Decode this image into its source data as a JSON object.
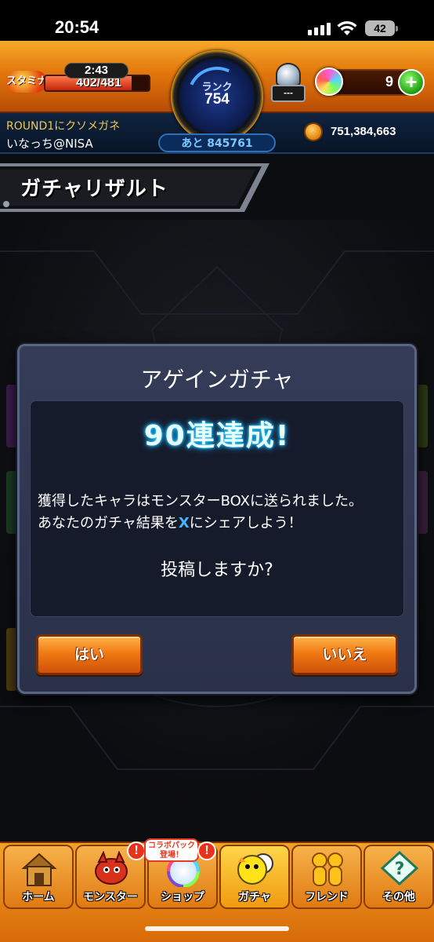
{
  "status_bar": {
    "time": "20:54",
    "battery": "42"
  },
  "hud": {
    "stamina_label": "スタミナ",
    "stamina_timer": "2:43",
    "stamina_value": "402/481",
    "stamina_fraction": 0.836,
    "rank_label": "ランク",
    "rank_value": "754",
    "rank_next": "あと 845761",
    "gacha_counter": "---",
    "orb_count": "9",
    "orb_plus": "+",
    "round_text": "ROUND1にクソメガネ",
    "player_name": "いなっち@NISA",
    "coin_value": "751,384,663"
  },
  "page_title": "ガチャリザルト",
  "dialog": {
    "title": "アゲインガチャ",
    "achievement": "90連達成!",
    "message_line1": "獲得したキャラはモンスターBOXに送られました。",
    "message_line2_before": "あなたのガチャ結果を",
    "message_line2_x": "X",
    "message_line2_after": "にシェアしよう！",
    "question": "投稿しますか?",
    "yes_label": "はい",
    "no_label": "いいえ"
  },
  "bottom_nav": {
    "items": [
      {
        "label": "ホーム",
        "icon": "home-icon"
      },
      {
        "label": "モンスター",
        "icon": "monster-icon",
        "alert": "!"
      },
      {
        "label": "ショップ",
        "icon": "shop-icon",
        "alert": "!"
      },
      {
        "label": "ガチャ",
        "icon": "gacha-icon"
      },
      {
        "label": "フレンド",
        "icon": "friend-icon"
      },
      {
        "label": "その他",
        "icon": "other-icon"
      }
    ],
    "promo_badge_line1": "コラボパック",
    "promo_badge_line2": "登場！"
  },
  "colors": {
    "accent_orange": "#f07a13",
    "dialog_bg": "#2a3149",
    "achievement_glow": "#22d6ff",
    "link_x": "#41b8ff"
  }
}
